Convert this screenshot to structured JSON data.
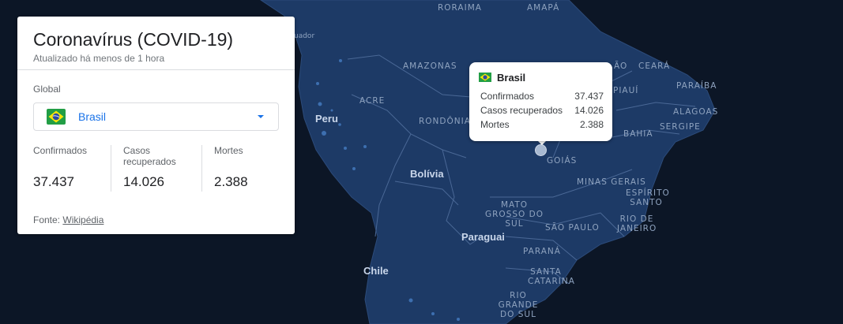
{
  "card": {
    "title": "Coronavírus (COVID-19)",
    "updated": "Atualizado há menos de 1 hora",
    "scope_label": "Global",
    "selector": {
      "country": "Brasil",
      "flag_icon": "brazil-flag-icon"
    },
    "stats": [
      {
        "label": "Confirmados",
        "value": "37.437"
      },
      {
        "label": "Casos recuperados",
        "value": "14.026"
      },
      {
        "label": "Mortes",
        "value": "2.388"
      }
    ],
    "source_prefix": "Fonte:",
    "source_link": "Wikipédia"
  },
  "tooltip": {
    "title": "Brasil",
    "rows": [
      {
        "label": "Confirmados",
        "value": "37.437"
      },
      {
        "label": "Casos recuperados",
        "value": "14.026"
      },
      {
        "label": "Mortes",
        "value": "2.388"
      }
    ]
  },
  "map": {
    "countries": [
      "Peru",
      "Bolívia",
      "Paraguai",
      "Chile"
    ],
    "states": [
      "RORAIMA",
      "AMAPÁ",
      "AMAZONAS",
      "ACRE",
      "RONDÔNIA",
      "CEARÁ",
      "PIAUÍ",
      "PARAÍBA",
      "ALAGOAS",
      "SERGIPE",
      "BAHIA",
      "GOIÁS",
      "MINAS GERAIS",
      "ESPÍRITO SANTO",
      "RIO DE JANEIRO",
      "MATO GROSSO DO SUL",
      "SÃO PAULO",
      "PARANÁ",
      "SANTA CATARINA",
      "RIO GRANDE DO SUL"
    ],
    "partial_labels": [
      "uador",
      "ÃO"
    ],
    "colors": {
      "ocean": "#0c1626",
      "land": "#1d3a66",
      "border": "#3d5a85"
    }
  }
}
